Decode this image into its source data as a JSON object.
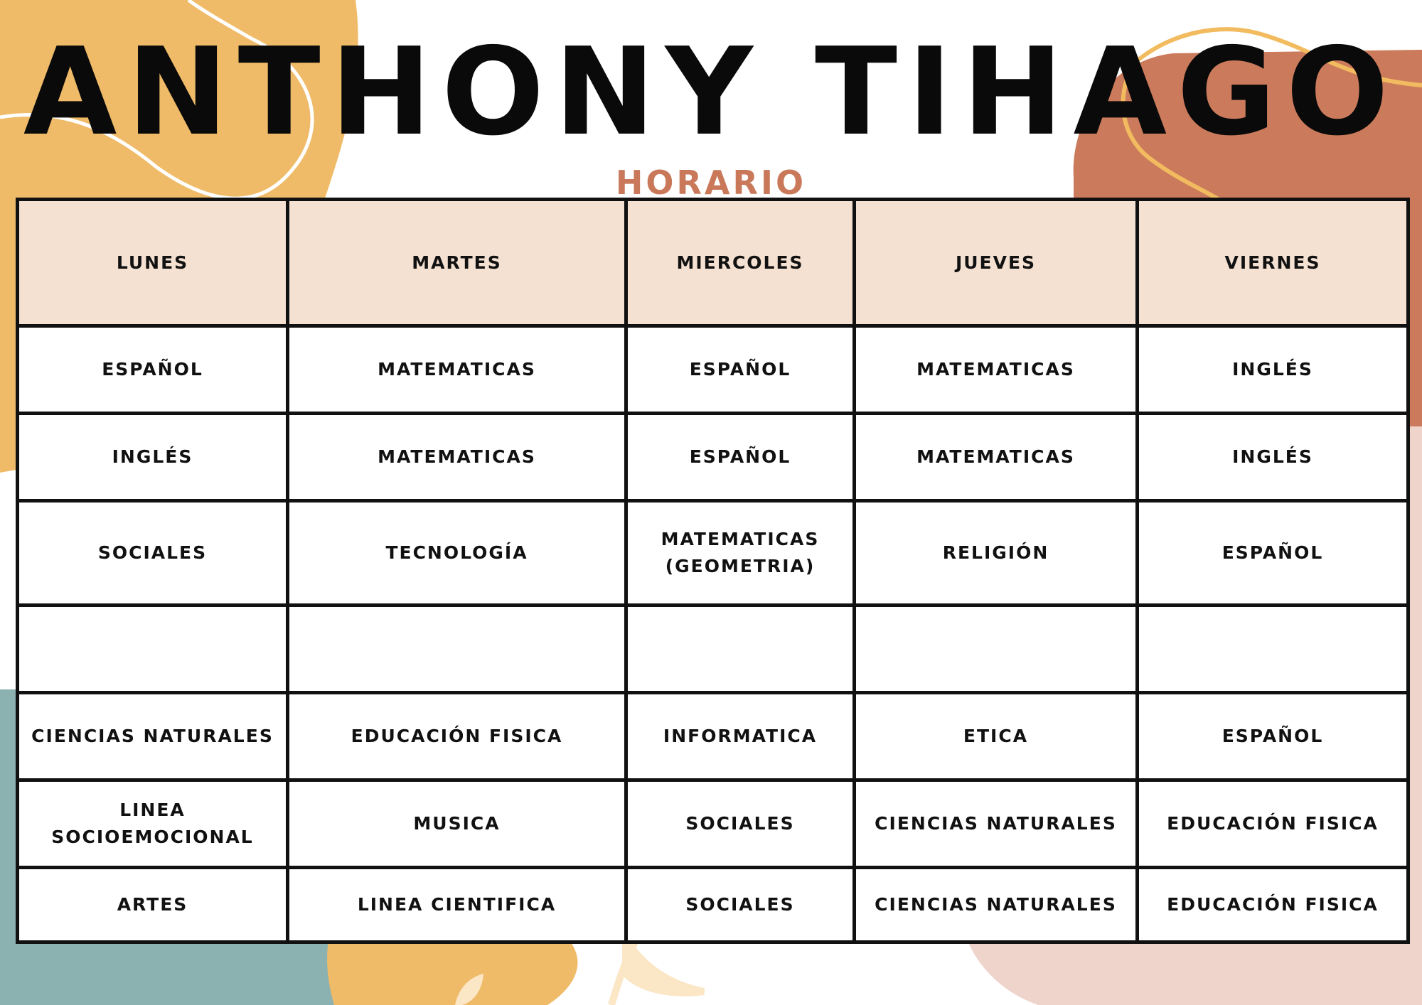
{
  "title": "ANTHONY TIHAGO",
  "subtitle": "HORARIO",
  "colors": {
    "accent": "#c9795a",
    "header_fill": "#f5e1d2",
    "mustard": "#efbb68",
    "terracotta": "#cb7b5c",
    "teal": "#8cb1b1",
    "blush": "#efd4cc",
    "border": "#111111"
  },
  "schedule": {
    "days": [
      "LUNES",
      "MARTES",
      "MIERCOLES",
      "JUEVES",
      "VIERNES"
    ],
    "rows": [
      [
        "ESPAÑOL",
        "MATEMATICAS",
        "ESPAÑOL",
        "MATEMATICAS",
        "INGLÉS"
      ],
      [
        "INGLÉS",
        "MATEMATICAS",
        "ESPAÑOL",
        "MATEMATICAS",
        "INGLÉS"
      ],
      [
        "SOCIALES",
        "TECNOLOGÍA",
        "MATEMATICAS\n(GEOMETRIA)",
        "RELIGIÓN",
        "ESPAÑOL"
      ],
      [
        "",
        "",
        "",
        "",
        ""
      ],
      [
        "CIENCIAS NATURALES",
        "EDUCACIÓN FISICA",
        "INFORMATICA",
        "ETICA",
        "ESPAÑOL"
      ],
      [
        "LINEA SOCIOEMOCIONAL",
        "MUSICA",
        "SOCIALES",
        "CIENCIAS NATURALES",
        "EDUCACIÓN FISICA"
      ],
      [
        "ARTES",
        "LINEA CIENTIFICA",
        "SOCIALES",
        "CIENCIAS NATURALES",
        "EDUCACIÓN FISICA"
      ]
    ]
  }
}
